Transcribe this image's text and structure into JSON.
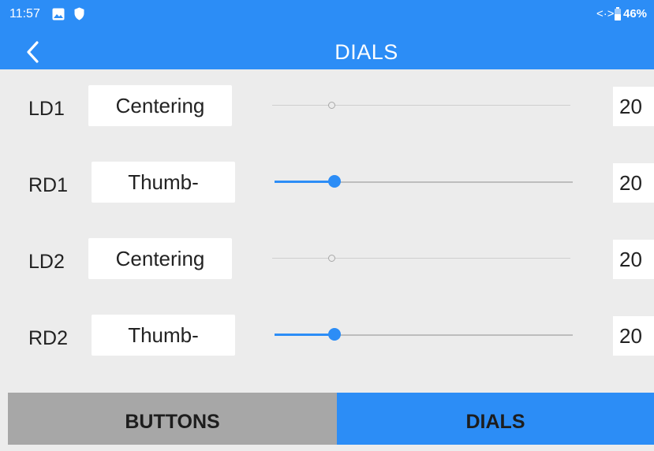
{
  "status_bar": {
    "time": "11:57",
    "battery": "46%",
    "icons": [
      "image-icon",
      "shield-icon",
      "link-icon",
      "battery-icon"
    ]
  },
  "header": {
    "title": "DIALS",
    "back_icon": "back-arrow-icon"
  },
  "dials": [
    {
      "label": "LD1",
      "mode": "Centering",
      "value": "20",
      "slider_position": 0.2,
      "active": false
    },
    {
      "label": "RD1",
      "mode": "Thumb-",
      "value": "20",
      "slider_position": 0.2,
      "active": true
    },
    {
      "label": "LD2",
      "mode": "Centering",
      "value": "20",
      "slider_position": 0.2,
      "active": false
    },
    {
      "label": "RD2",
      "mode": "Thumb-",
      "value": "20",
      "slider_position": 0.2,
      "active": true
    }
  ],
  "tabs": [
    {
      "label": "BUTTONS",
      "selected": false
    },
    {
      "label": "DIALS",
      "selected": true
    }
  ],
  "colors": {
    "accent": "#2c8df6",
    "background": "#ececec",
    "inactive_tab": "#a7a7a7"
  }
}
